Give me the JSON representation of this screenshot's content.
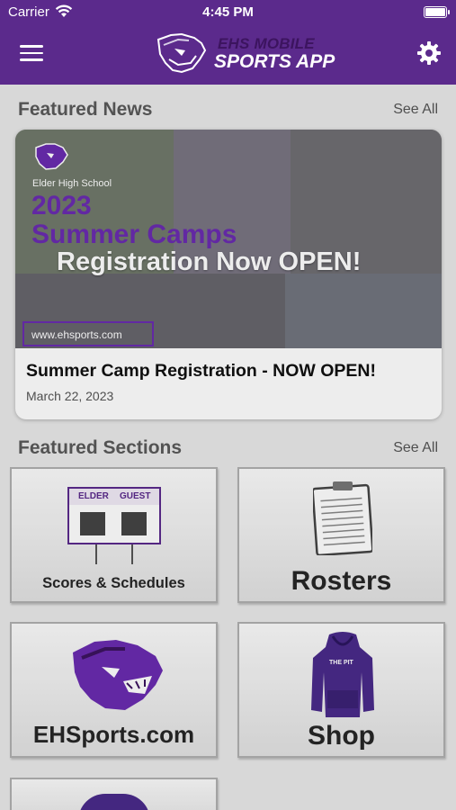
{
  "status_bar": {
    "carrier": "Carrier",
    "time": "4:45 PM"
  },
  "header": {
    "logo_line1": "EHS MOBILE",
    "logo_line2": "SPORTS APP"
  },
  "featured_news": {
    "title": "Featured News",
    "see_all": "See All",
    "card": {
      "image_school": "Elder High School",
      "image_year": "2023",
      "image_camps": "Summer Camps",
      "image_registration": "Registration Now OPEN!",
      "image_url": "www.ehsports.com",
      "headline": "Summer Camp Registration - NOW OPEN!",
      "date": "March 22, 2023"
    }
  },
  "featured_sections": {
    "title": "Featured Sections",
    "see_all": "See All",
    "items": [
      {
        "label": "Scores & Schedules",
        "board_home": "ELDER",
        "board_away": "GUEST",
        "icon": "scoreboard-icon"
      },
      {
        "label": "Rosters",
        "icon": "clipboard-icon"
      },
      {
        "label": "EHSports.com",
        "icon": "panther-icon"
      },
      {
        "label": "Shop",
        "hoodie_text": "THE PIT",
        "icon": "hoodie-icon"
      }
    ]
  },
  "colors": {
    "brand": "#5b2a8c",
    "accent": "#6a2cb0",
    "background": "#e9e9e9"
  }
}
